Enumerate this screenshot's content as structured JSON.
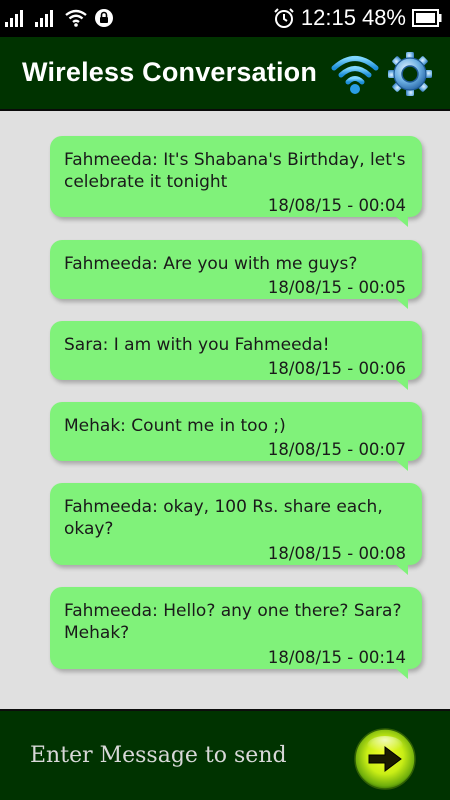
{
  "status_bar": {
    "time": "12:15",
    "battery": "48%",
    "icons": [
      "signal-icon",
      "signal-icon",
      "wifi-icon",
      "lock-icon",
      "alarm-icon",
      "battery-icon"
    ]
  },
  "app_bar": {
    "title": "Wireless Conversation",
    "icons": [
      "wifi-icon",
      "gear-icon"
    ]
  },
  "messages": [
    {
      "text": "Fahmeeda: It's Shabana's Birthday, let's celebrate it tonight",
      "time": "18/08/15 - 00:04"
    },
    {
      "text": "Fahmeeda: Are you with me guys?",
      "time": "18/08/15 - 00:05"
    },
    {
      "text": "Sara: I am with you Fahmeeda!",
      "time": "18/08/15 - 00:06"
    },
    {
      "text": "Mehak: Count me in too ;)",
      "time": "18/08/15 - 00:07"
    },
    {
      "text": "Fahmeeda: okay, 100 Rs. share each, okay?",
      "time": "18/08/15 - 00:08"
    },
    {
      "text": "Fahmeeda: Hello? any one there? Sara? Mehak?",
      "time": "18/08/15 - 00:14"
    }
  ],
  "input": {
    "placeholder": "Enter Message to send",
    "value": ""
  },
  "colors": {
    "bar": "#003300",
    "bubble": "#80f27a",
    "background": "#e0e0e0"
  }
}
